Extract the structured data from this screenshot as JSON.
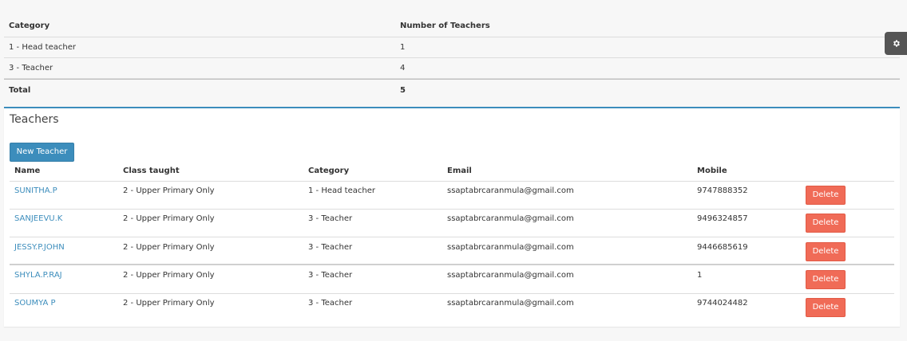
{
  "summary": {
    "headers": [
      "Category",
      "Number of Teachers"
    ],
    "rows": [
      [
        "1 - Head teacher",
        "1"
      ],
      [
        "3 - Teacher",
        "4"
      ]
    ],
    "total_label": "Total",
    "total_value": "5"
  },
  "panel": {
    "title": "Teachers",
    "new_button": "New Teacher",
    "columns": [
      "Name",
      "Class taught",
      "Category",
      "Email",
      "Mobile"
    ],
    "delete_label": "Delete",
    "rows": [
      {
        "name": "SUNITHA.P",
        "class": "2 - Upper Primary Only",
        "category": "1 - Head teacher",
        "email": "ssaptabrcaranmula@gmail.com",
        "mobile": "9747888352"
      },
      {
        "name": "SANJEEVU.K",
        "class": "2 - Upper Primary Only",
        "category": "3 - Teacher",
        "email": "ssaptabrcaranmula@gmail.com",
        "mobile": "9496324857"
      },
      {
        "name": "JESSY.P.JOHN",
        "class": "2 - Upper Primary Only",
        "category": "3 - Teacher",
        "email": "ssaptabrcaranmula@gmail.com",
        "mobile": "9446685619"
      },
      {
        "name": "SHYLA.P.RAJ",
        "class": "2 - Upper Primary Only",
        "category": "3 - Teacher",
        "email": "ssaptabrcaranmula@gmail.com",
        "mobile": "1"
      },
      {
        "name": "SOUMYA P",
        "class": "2 - Upper Primary Only",
        "category": "3 - Teacher",
        "email": "ssaptabrcaranmula@gmail.com",
        "mobile": "9744024482"
      }
    ]
  },
  "icons": {
    "settings": "gear-icon"
  },
  "colors": {
    "primary": "#3c8dbc",
    "danger": "#f06b57",
    "gear_bg": "#555555"
  }
}
